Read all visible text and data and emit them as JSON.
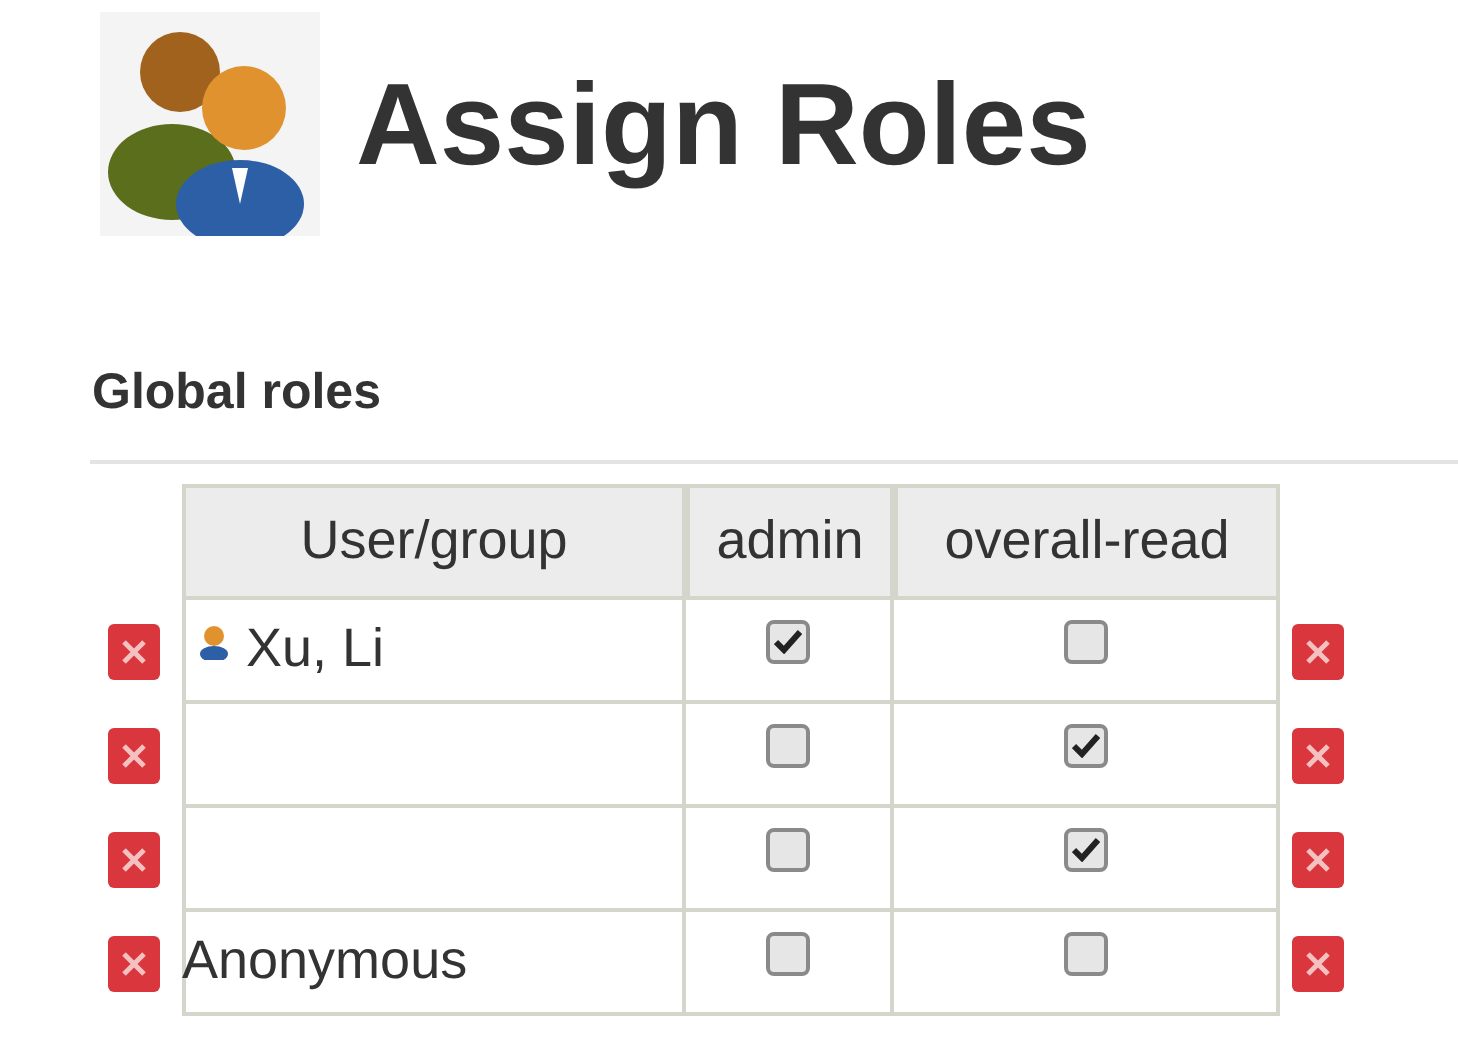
{
  "title": "Assign Roles",
  "section": "Global roles",
  "columns": [
    "User/group",
    "admin",
    "overall-read"
  ],
  "rows": [
    {
      "kind": "user",
      "name": "Xu, Li",
      "roles": [
        {
          "checked": true
        },
        {
          "checked": false
        }
      ]
    },
    {
      "kind": "plain",
      "roles": [
        {
          "checked": false
        },
        {
          "checked": true
        }
      ]
    },
    {
      "kind": "plain",
      "roles": [
        {
          "checked": false
        },
        {
          "checked": true
        }
      ]
    },
    {
      "kind": "plain",
      "name": "Anonymous",
      "roles": [
        {
          "checked": false
        },
        {
          "checked": false
        }
      ]
    }
  ]
}
